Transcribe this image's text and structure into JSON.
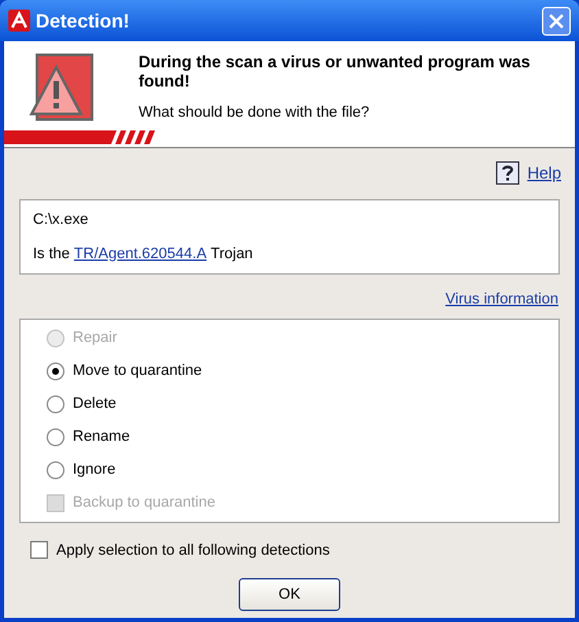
{
  "window": {
    "title": "Detection!"
  },
  "header": {
    "heading": "During the scan a virus or unwanted program was found!",
    "question": "What should be done with the file?"
  },
  "help_link": "Help",
  "file": {
    "path": "C:\\x.exe",
    "prefix": "Is the",
    "virus_link": "TR/Agent.620544.A",
    "suffix": "Trojan"
  },
  "virus_info_link": "Virus information",
  "actions": [
    {
      "label": "Repair",
      "selected": false,
      "disabled": true
    },
    {
      "label": "Move to quarantine",
      "selected": true,
      "disabled": false
    },
    {
      "label": "Delete",
      "selected": false,
      "disabled": false
    },
    {
      "label": "Rename",
      "selected": false,
      "disabled": false
    },
    {
      "label": "Ignore",
      "selected": false,
      "disabled": false
    }
  ],
  "backup": {
    "label": "Backup to quarantine",
    "checked": false,
    "disabled": true
  },
  "apply_all": {
    "label": "Apply selection to all following detections",
    "checked": false
  },
  "ok_button": "OK"
}
